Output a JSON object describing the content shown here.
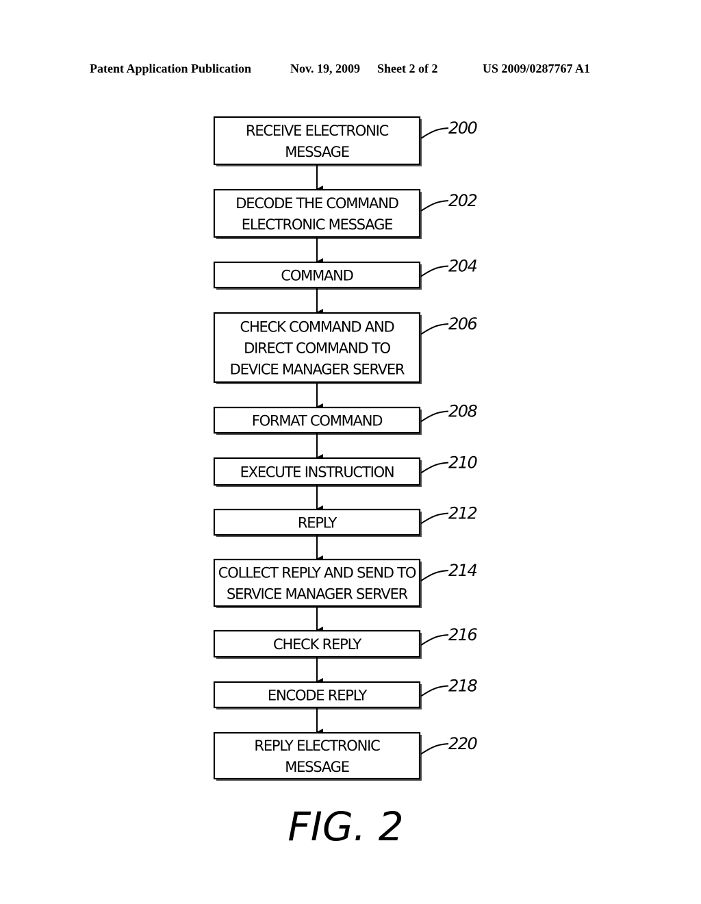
{
  "header": {
    "left": "Patent Application Publication",
    "date": "Nov. 19, 2009",
    "sheet": "Sheet 2 of 2",
    "number": "US 2009/0287767 A1"
  },
  "flowchart": {
    "steps": [
      {
        "ref": "200",
        "lines": [
          "RECEIVE ELECTRONIC",
          "MESSAGE"
        ]
      },
      {
        "ref": "202",
        "lines": [
          "DECODE THE COMMAND",
          "ELECTRONIC MESSAGE"
        ]
      },
      {
        "ref": "204",
        "lines": [
          "COMMAND"
        ]
      },
      {
        "ref": "206",
        "lines": [
          "CHECK COMMAND AND",
          "DIRECT COMMAND TO",
          "DEVICE MANAGER SERVER"
        ]
      },
      {
        "ref": "208",
        "lines": [
          "FORMAT COMMAND"
        ]
      },
      {
        "ref": "210",
        "lines": [
          "EXECUTE INSTRUCTION"
        ]
      },
      {
        "ref": "212",
        "lines": [
          "REPLY"
        ]
      },
      {
        "ref": "214",
        "lines": [
          "COLLECT REPLY AND SEND TO",
          "SERVICE MANAGER SERVER"
        ]
      },
      {
        "ref": "216",
        "lines": [
          "CHECK REPLY"
        ]
      },
      {
        "ref": "218",
        "lines": [
          "ENCODE REPLY"
        ]
      },
      {
        "ref": "220",
        "lines": [
          "REPLY ELECTRONIC",
          "MESSAGE"
        ]
      }
    ]
  },
  "figure_label": "FIG. 2"
}
